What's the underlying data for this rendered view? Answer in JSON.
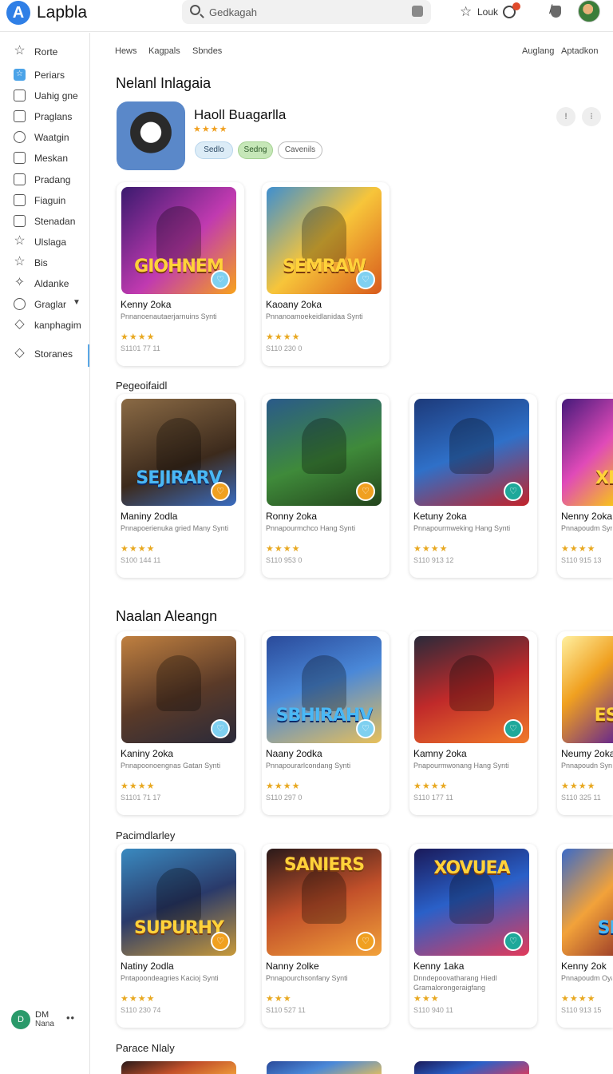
{
  "header": {
    "app_name": "Lapbla",
    "logo_letter": "A",
    "search_placeholder": "Gedkagah",
    "look_label": "Louk",
    "accent_color": "#2f7fe6"
  },
  "sidebar": {
    "items": [
      {
        "label": "Rorte",
        "icon": "star-icon"
      },
      {
        "label": "Periars",
        "icon": "starred-folder-icon"
      },
      {
        "label": "Uahig gne",
        "icon": "page-icon"
      },
      {
        "label": "Praglans",
        "icon": "folder-icon"
      },
      {
        "label": "Waatgin",
        "icon": "eye-icon"
      },
      {
        "label": "Meskan",
        "icon": "grid-icon"
      },
      {
        "label": "Pradang",
        "icon": "document-icon"
      },
      {
        "label": "Fiaguin",
        "icon": "bookmark-icon"
      },
      {
        "label": "Stenadan",
        "icon": "file-icon"
      },
      {
        "label": "Ulslaga",
        "icon": "star-icon"
      },
      {
        "label": "Bis",
        "icon": "star-icon"
      },
      {
        "label": "Aldanke",
        "icon": "badge-icon"
      },
      {
        "label": "Graglar",
        "icon": "gamepad-icon"
      },
      {
        "label": "kanphagim",
        "icon": "diamond-icon"
      },
      {
        "label": "Storanes",
        "icon": "tag-icon"
      }
    ],
    "footer": {
      "badge": "D",
      "line1": "DM",
      "line2": "Nana",
      "more": "••"
    }
  },
  "nav": {
    "left": [
      "Hews",
      "Kagpals",
      "Sbndes"
    ],
    "right": [
      "Auglang",
      "Aptadkon"
    ]
  },
  "featured": {
    "section_title": "Nelanl Inlagaia",
    "title": "Haoll Buagarlla",
    "rating_stars": "★★★★",
    "tags": [
      "Sedlo",
      "Sedng",
      "Cavenils"
    ]
  },
  "sections": [
    {
      "id": "s1",
      "cards": [
        {
          "art_text": "GIOHNEM",
          "title": "Kenny 2oka",
          "desc": "Pnnanoenautaerjarnuins Synti",
          "stars": "★★★★",
          "meta": "S1101 77 11"
        },
        {
          "art_text": "SEMRAW",
          "title": "Kaoany 2oka",
          "desc": "Pnnanoamoekeidlanidaa Synti",
          "stars": "★★★★",
          "meta": "S110 230 0"
        }
      ]
    },
    {
      "title": "Pegeoifaidl",
      "cards": [
        {
          "art_text": "SEJIRARV",
          "title": "Maniny 2odla",
          "desc": "Pnnapoerienuka gried Many Synti",
          "stars": "★★★★",
          "meta": "S100 144 11"
        },
        {
          "art_text": "",
          "title": "Ronny 2oka",
          "desc": "Pnnapourmchco Hang Synti",
          "stars": "★★★★",
          "meta": "S110 953 0"
        },
        {
          "art_text": "",
          "title": "Ketuny 2oka",
          "desc": "Pnnapourmweking Hang Synti",
          "stars": "★★★★",
          "meta": "S110 913 12"
        },
        {
          "art_text": "XE",
          "title": "Nenny 2oka",
          "desc": "Pnnapoudm Synti",
          "stars": "★★★★",
          "meta": "S110 915 13"
        }
      ]
    },
    {
      "title": "Naalan Aleangn",
      "cards": [
        {
          "art_text": "",
          "title": "Kaniny 2oka",
          "desc": "Pnnapoonoengnas Gatan Synti",
          "stars": "★★★★",
          "meta": "S1101 71 17"
        },
        {
          "art_text": "SBHIRAHV",
          "title": "Naany 2odka",
          "desc": "Pnnapourarlcondang Synti",
          "stars": "★★★★",
          "meta": "S110 297 0"
        },
        {
          "art_text": "",
          "title": "Kamny 2oka",
          "desc": "Pnapourmwonang Hang Synti",
          "stars": "★★★★",
          "meta": "S110 177 11"
        },
        {
          "art_text": "ES",
          "title": "Neumy 2oka",
          "desc": "Pnnapoudn Synti",
          "stars": "★★★★",
          "meta": "S110 325 11"
        }
      ]
    },
    {
      "title": "Pacimdlarley",
      "cards": [
        {
          "art_text": "SUPURHY",
          "title": "Natiny 2odla",
          "desc": "Pntapoondeagries Kacioj Synti",
          "stars": "★★★★",
          "meta": "S110 230 74"
        },
        {
          "art_text": "SANIERS",
          "title": "Nanny 2olke",
          "desc": "Pnnapourchsonfany Synti",
          "stars": "★★★",
          "meta": "S110 527 11"
        },
        {
          "art_text": "XOVUEA",
          "title": "Kenny 1aka",
          "desc": "Dnndepoovatharang Hiedl Gramalorongeraigfang",
          "stars": "★★★",
          "meta": "S110 940 11"
        },
        {
          "art_text": "SE",
          "title": "Kenny 2ok",
          "desc": "Pnnapoudm Oyanl",
          "stars": "★★★★",
          "meta": "S110 913 15"
        }
      ]
    },
    {
      "title": "Parace Nlaly"
    }
  ],
  "colors": {
    "fav_light": "#7fd0f0",
    "fav_orange": "#f0a020",
    "fav_teal": "#1ea89a",
    "star": "#e8a820"
  }
}
